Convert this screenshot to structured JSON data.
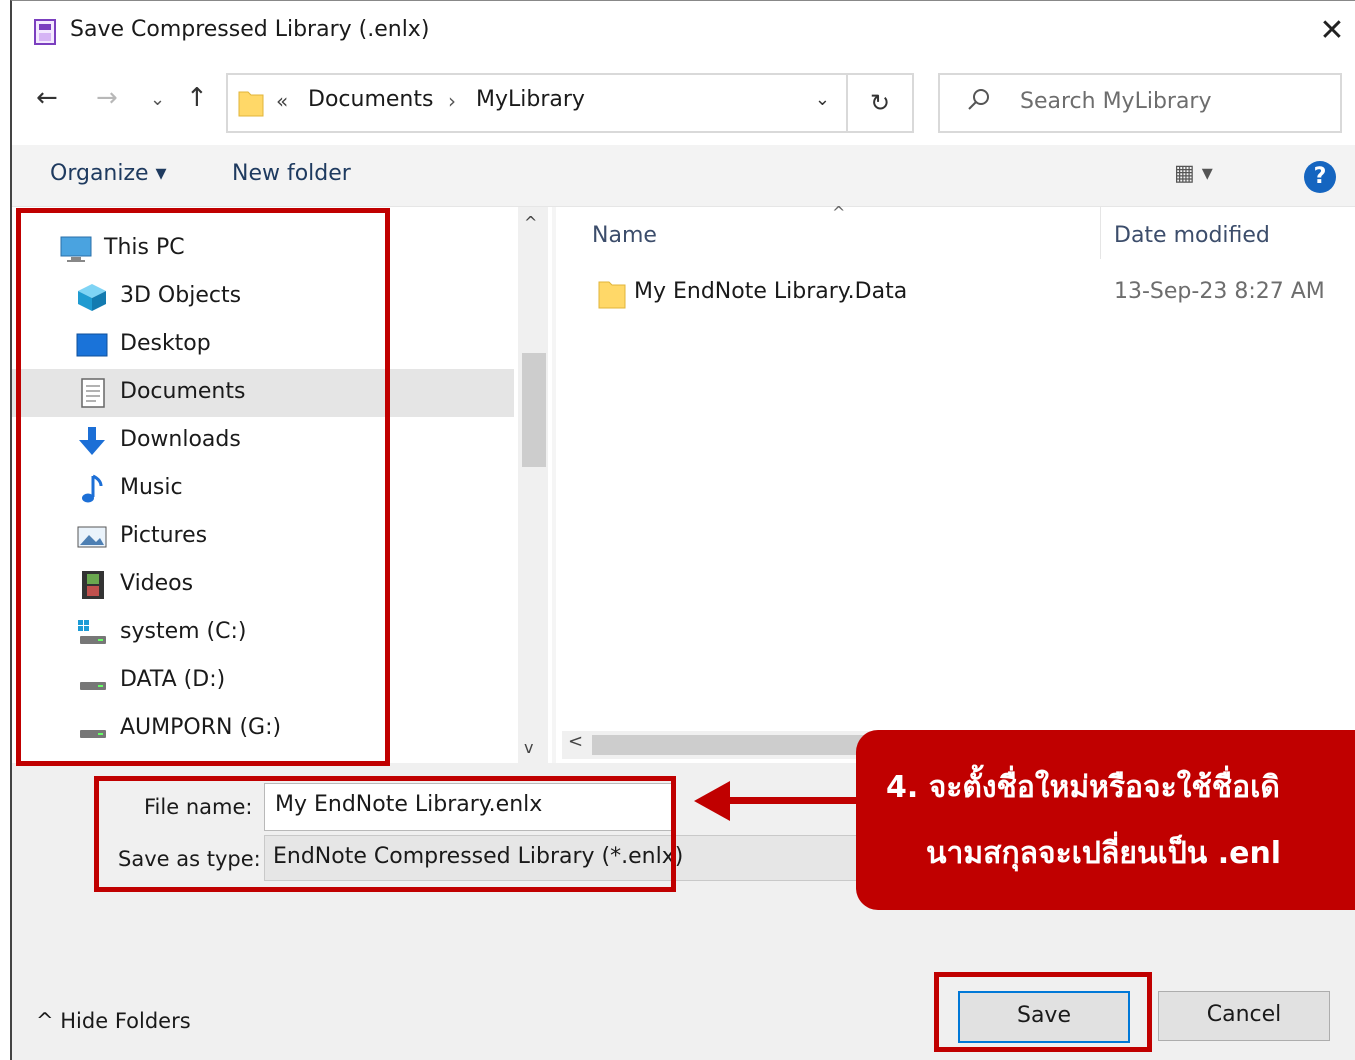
{
  "window": {
    "title": "Save Compressed Library (.enlx)",
    "close": "✕"
  },
  "nav": {
    "back": "←",
    "forward": "→",
    "recent": "⌄",
    "up": "↑",
    "address": {
      "chevron": "«",
      "segments": [
        "Documents",
        "MyLibrary"
      ],
      "separator": "›",
      "dropdown": "⌄"
    },
    "refresh": "↻",
    "search_placeholder": "Search MyLibrary"
  },
  "toolbar": {
    "organize": "Organize ▾",
    "new_folder": "New folder",
    "view": "▦ ▾",
    "help": "?"
  },
  "sidebar": {
    "items": [
      {
        "label": "This PC",
        "icon": "monitor-icon"
      },
      {
        "label": "3D Objects",
        "icon": "cube-icon"
      },
      {
        "label": "Desktop",
        "icon": "desktop-icon"
      },
      {
        "label": "Documents",
        "icon": "document-icon",
        "selected": true
      },
      {
        "label": "Downloads",
        "icon": "download-arrow-icon"
      },
      {
        "label": "Music",
        "icon": "music-note-icon"
      },
      {
        "label": "Pictures",
        "icon": "picture-icon"
      },
      {
        "label": "Videos",
        "icon": "film-icon"
      },
      {
        "label": "system (C:)",
        "icon": "windows-drive-icon"
      },
      {
        "label": "DATA (D:)",
        "icon": "drive-icon"
      },
      {
        "label": "AUMPORN (G:)",
        "icon": "drive-icon"
      }
    ],
    "scroll_up": "^",
    "scroll_down": "v"
  },
  "filelist": {
    "columns": {
      "name": "Name",
      "date": "Date modified",
      "sort_indicator": "^"
    },
    "rows": [
      {
        "name": "My EndNote Library.Data",
        "date": "13-Sep-23 8:27 AM",
        "icon": "folder-icon"
      }
    ],
    "hscroll_left": "<"
  },
  "form": {
    "filename_label": "File name:",
    "filename_value": "My EndNote Library.enlx",
    "type_label": "Save as type:",
    "type_value": "EndNote Compressed Library (*.enlx)",
    "hide_folders": "^  Hide Folders",
    "save": "Save",
    "cancel": "Cancel"
  },
  "annotation": {
    "line1": "4. จะตั้งชื่อใหม่หรือจะใช้ชื่อเดิ",
    "line2": "นามสกุลจะเปลี่ยนเป็น .enl",
    "color": "#c00000"
  }
}
